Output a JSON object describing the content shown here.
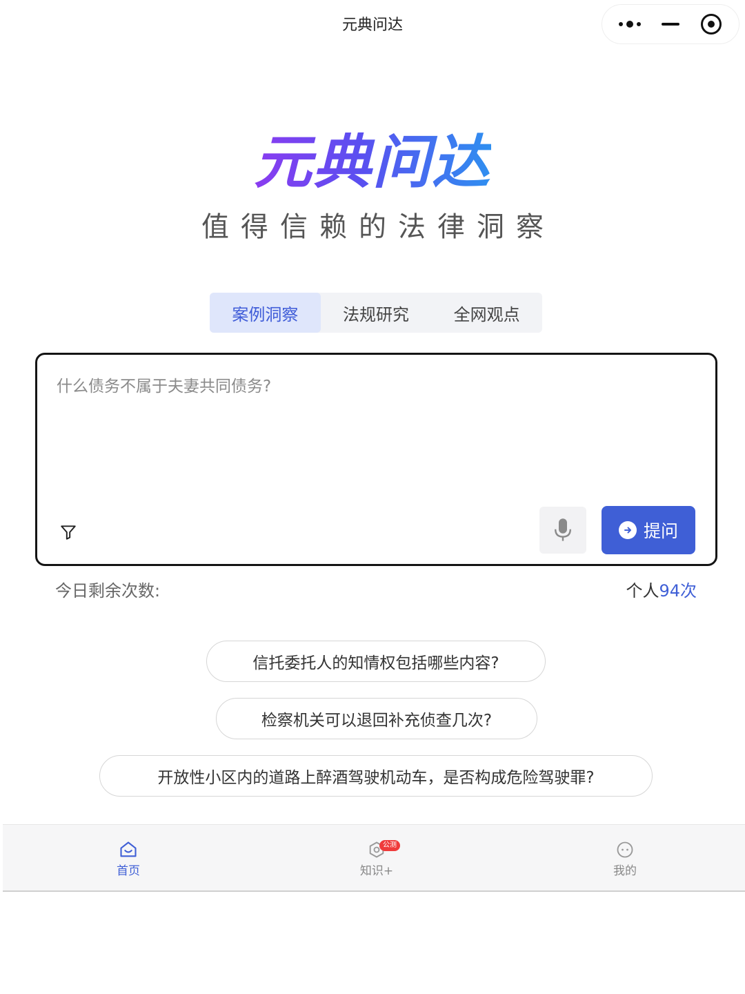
{
  "header": {
    "title": "元典问达",
    "capsule": {
      "more_icon": "more-dots-icon",
      "minimize_icon": "minimize-icon",
      "close_icon": "target-close-icon"
    }
  },
  "brand": {
    "logo_text": "元典问达",
    "slogan": "值得信赖的法律洞察"
  },
  "tabs": [
    {
      "label": "案例洞察",
      "active": true
    },
    {
      "label": "法规研究",
      "active": false
    },
    {
      "label": "全网观点",
      "active": false
    }
  ],
  "ask": {
    "placeholder": "什么债务不属于夫妻共同债务?",
    "value": "",
    "submit_label": "提问",
    "filter_icon": "filter-icon",
    "mic_icon": "microphone-icon"
  },
  "quota": {
    "label": "今日剩余次数:",
    "prefix": "个人",
    "count": "94",
    "suffix": "次"
  },
  "suggestions": [
    "信托委托人的知情权包括哪些内容?",
    "检察机关可以退回补充侦查几次?",
    "开放性小区内的道路上醉酒驾驶机动车，是否构成危险驾驶罪?"
  ],
  "tabbar": {
    "items": [
      {
        "label": "首页",
        "icon": "home-icon",
        "active": true
      },
      {
        "label": "知识+",
        "icon": "knowledge-icon",
        "badge": "公测",
        "active": false
      },
      {
        "label": "我的",
        "icon": "profile-icon",
        "active": false
      }
    ]
  },
  "colors": {
    "accent": "#3f5fd6",
    "tab_active_bg": "#dfe6fb",
    "gradient_start": "#8a3cf0",
    "gradient_end": "#2f8ff0"
  }
}
